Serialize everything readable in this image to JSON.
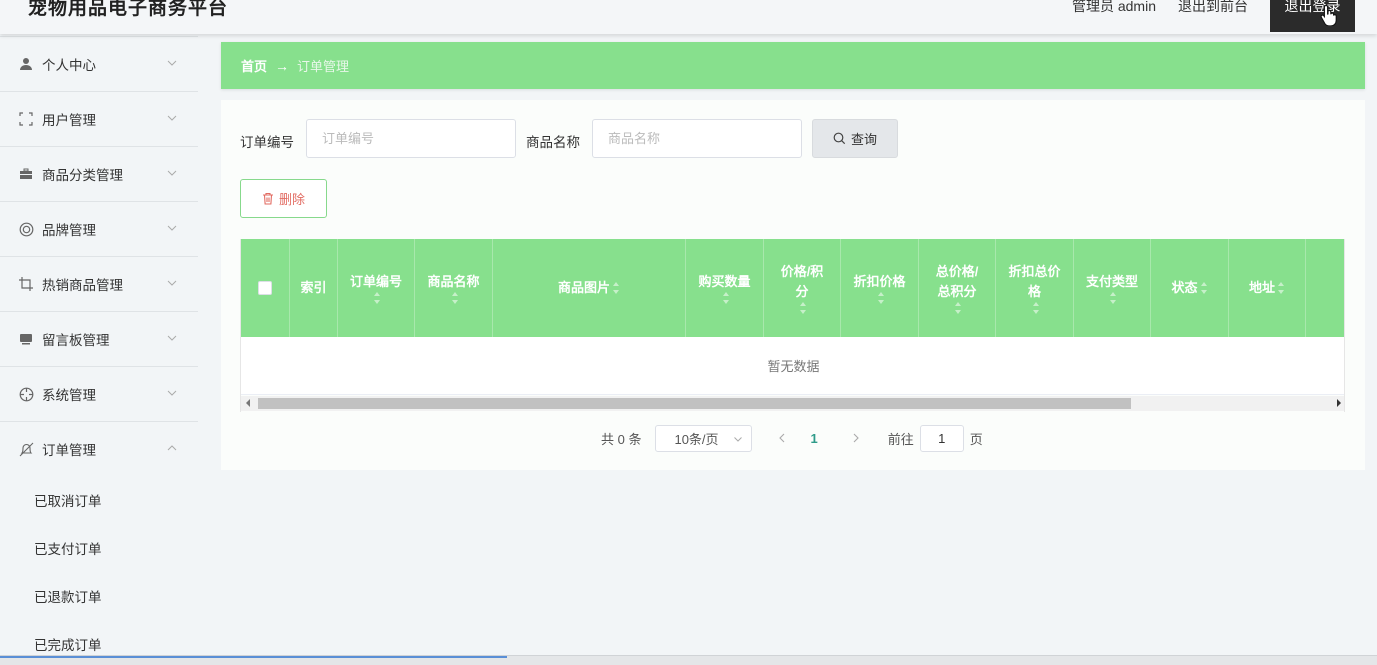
{
  "header": {
    "app_title": "宠物用品电子商务平台",
    "admin_label": "管理员 admin",
    "back_front_label": "退出到前台",
    "logout_label": "退出登录"
  },
  "sidebar": {
    "items": [
      {
        "label": "个人中心",
        "icon": "user-icon"
      },
      {
        "label": "用户管理",
        "icon": "frame-icon"
      },
      {
        "label": "商品分类管理",
        "icon": "briefcase-icon"
      },
      {
        "label": "品牌管理",
        "icon": "lifebuoy-icon"
      },
      {
        "label": "热销商品管理",
        "icon": "crop-icon"
      },
      {
        "label": "留言板管理",
        "icon": "monitor-icon"
      },
      {
        "label": "系统管理",
        "icon": "crosshair-icon"
      },
      {
        "label": "订单管理",
        "icon": "bell-off-icon",
        "expanded": true
      }
    ],
    "sub_items": [
      "已取消订单",
      "已支付订单",
      "已退款订单",
      "已完成订单"
    ]
  },
  "breadcrumb": {
    "home": "首页",
    "arrow": "→",
    "current": "订单管理"
  },
  "search": {
    "order_no_label": "订单编号",
    "order_no_placeholder": "订单编号",
    "product_name_label": "商品名称",
    "product_name_placeholder": "商品名称",
    "search_button": "查询"
  },
  "actions": {
    "delete_button": "删除"
  },
  "table": {
    "columns": [
      "索引",
      "订单编号",
      "商品名称",
      "商品图片",
      "购买数量",
      "价格/积分",
      "折扣价格",
      "总价格/总积分",
      "折扣总价格",
      "支付类型",
      "状态",
      "地址"
    ],
    "empty_text": "暂无数据"
  },
  "pagination": {
    "total": "共 0 条",
    "page_size": "10条/页",
    "current_page": "1",
    "goto_label": "前往",
    "goto_value": "1",
    "page_suffix": "页"
  },
  "colors": {
    "accent_green": "#87e08d",
    "page_num": "#2e9b89",
    "delete_red": "#e26b62"
  }
}
